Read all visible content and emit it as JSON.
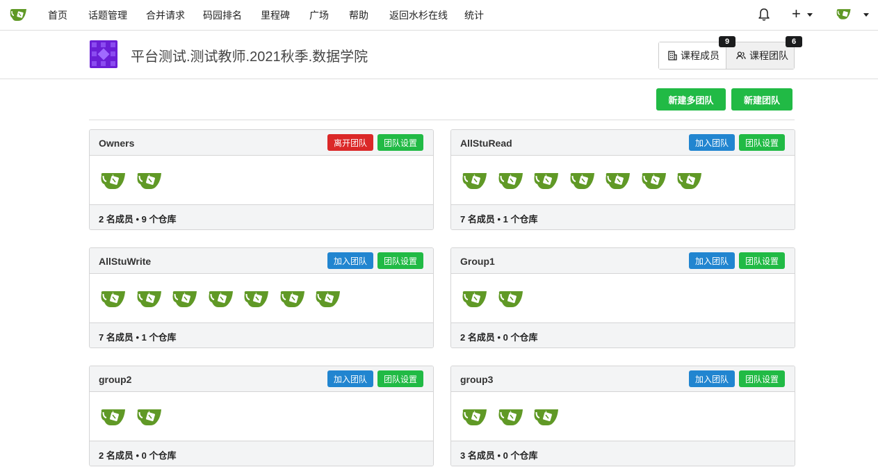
{
  "nav": {
    "items": [
      "首页",
      "话题管理",
      "合并请求",
      "码园排名",
      "里程碑",
      "广场",
      "帮助",
      "返回水杉在线",
      "统计"
    ],
    "plus": "+"
  },
  "org": {
    "title": "平台测试.测试教师.2021秋季.数据学院",
    "tabs": [
      {
        "label": "课程成员",
        "count": "9"
      },
      {
        "label": "课程团队",
        "count": "6"
      }
    ]
  },
  "actions": {
    "new_multi_team": "新建多团队",
    "new_team": "新建团队"
  },
  "colors": {
    "brand_green": "#21ba45",
    "danger_red": "#db2828",
    "primary_blue": "#2185d0",
    "org_avatar": "#6b1fd6",
    "member_avatar": "#609926"
  },
  "teams": [
    {
      "name": "Owners",
      "primary_btn": "离开团队",
      "primary_type": "leave",
      "settings_btn": "团队设置",
      "members": 2,
      "summary": "2 名成员 • 9 个仓库"
    },
    {
      "name": "AllStuRead",
      "primary_btn": "加入团队",
      "primary_type": "join",
      "settings_btn": "团队设置",
      "members": 7,
      "summary": "7 名成员 • 1 个仓库"
    },
    {
      "name": "AllStuWrite",
      "primary_btn": "加入团队",
      "primary_type": "join",
      "settings_btn": "团队设置",
      "members": 7,
      "summary": "7 名成员 • 1 个仓库"
    },
    {
      "name": "Group1",
      "primary_btn": "加入团队",
      "primary_type": "join",
      "settings_btn": "团队设置",
      "members": 2,
      "summary": "2 名成员 • 0 个仓库"
    },
    {
      "name": "group2",
      "primary_btn": "加入团队",
      "primary_type": "join",
      "settings_btn": "团队设置",
      "members": 2,
      "summary": "2 名成员 • 0 个仓库"
    },
    {
      "name": "group3",
      "primary_btn": "加入团队",
      "primary_type": "join",
      "settings_btn": "团队设置",
      "members": 3,
      "summary": "3 名成员 • 0 个仓库"
    }
  ]
}
